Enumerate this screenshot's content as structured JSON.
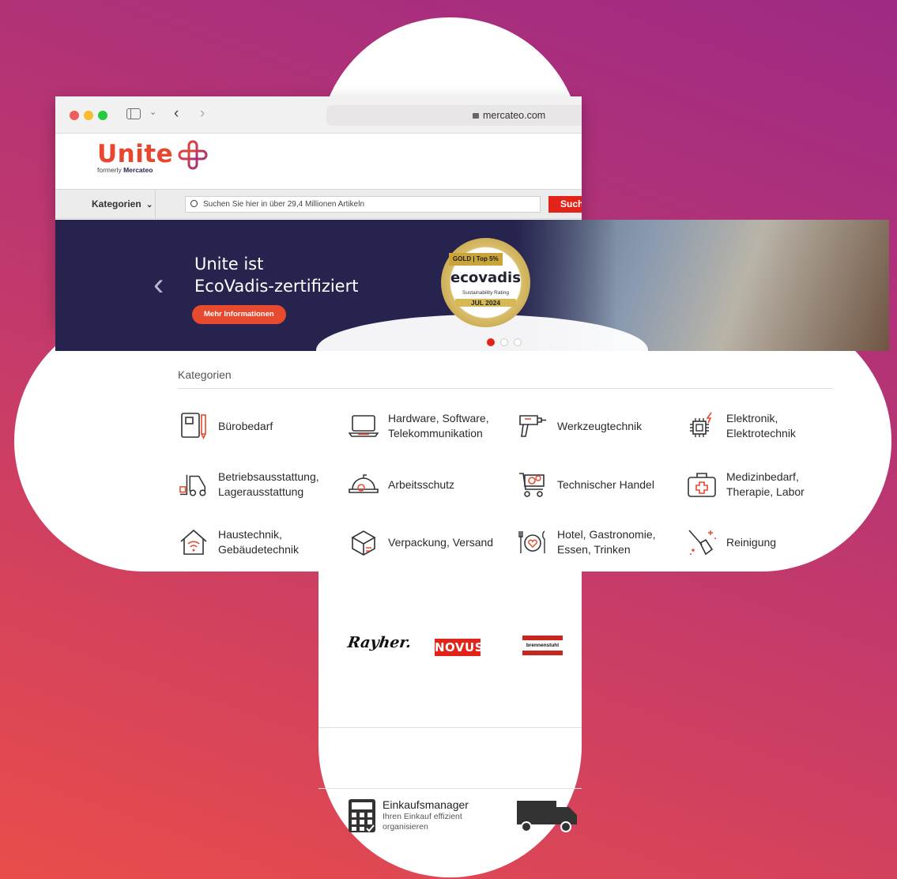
{
  "browser": {
    "url": "mercateo.com",
    "traffic_colors": [
      "#ee5f57",
      "#f5bd2f",
      "#27c93f"
    ]
  },
  "brand": {
    "logo_text": "Unite",
    "tagline_prefix": "formerly",
    "tagline_brand": "Mercateo"
  },
  "nav": {
    "categories_label": "Kategorien",
    "search_placeholder": "Suchen Sie hier in über 29,4 Millionen Artikeln",
    "search_button": "Such"
  },
  "hero": {
    "headline_line1": "Unite ist",
    "headline_line2": "EcoVadis-zertifiziert",
    "cta": "Mehr Informationen",
    "badge_top": "GOLD | Top 5%",
    "badge_brand": "ecovadis",
    "badge_sub": "Sustainability Rating",
    "badge_date": "JUL 2024",
    "active_slide": 1,
    "slide_count": 3
  },
  "categories": {
    "heading": "Kategorien",
    "items": [
      {
        "line1": "Bürobedarf",
        "line2": ""
      },
      {
        "line1": "Hardware, Software,",
        "line2": "Telekommunikation"
      },
      {
        "line1": "Werkzeugtechnik",
        "line2": ""
      },
      {
        "line1": "Elektronik,",
        "line2": "Elektrotechnik"
      },
      {
        "line1": "Betriebsausstattung,",
        "line2": "Lagerausstattung"
      },
      {
        "line1": "Arbeitsschutz",
        "line2": ""
      },
      {
        "line1": "Technischer Handel",
        "line2": ""
      },
      {
        "line1": "Medizinbedarf,",
        "line2": "Therapie, Labor"
      },
      {
        "line1": "Haustechnik,",
        "line2": "Gebäudetechnik"
      },
      {
        "line1": "Verpackung, Versand",
        "line2": ""
      },
      {
        "line1": "Hotel, Gastronomie,",
        "line2": "Essen, Trinken"
      },
      {
        "line1": "Reinigung",
        "line2": ""
      }
    ]
  },
  "brands": [
    "Rayher.",
    "novus",
    "brennenstuhl"
  ],
  "features": {
    "title": "Einkaufsmanager",
    "desc_line1": "Ihren Einkauf effizient",
    "desc_line2": "organisieren"
  },
  "colors": {
    "accent": "#e84a2f",
    "navy": "#26244f",
    "gold": "#c9a43a"
  }
}
